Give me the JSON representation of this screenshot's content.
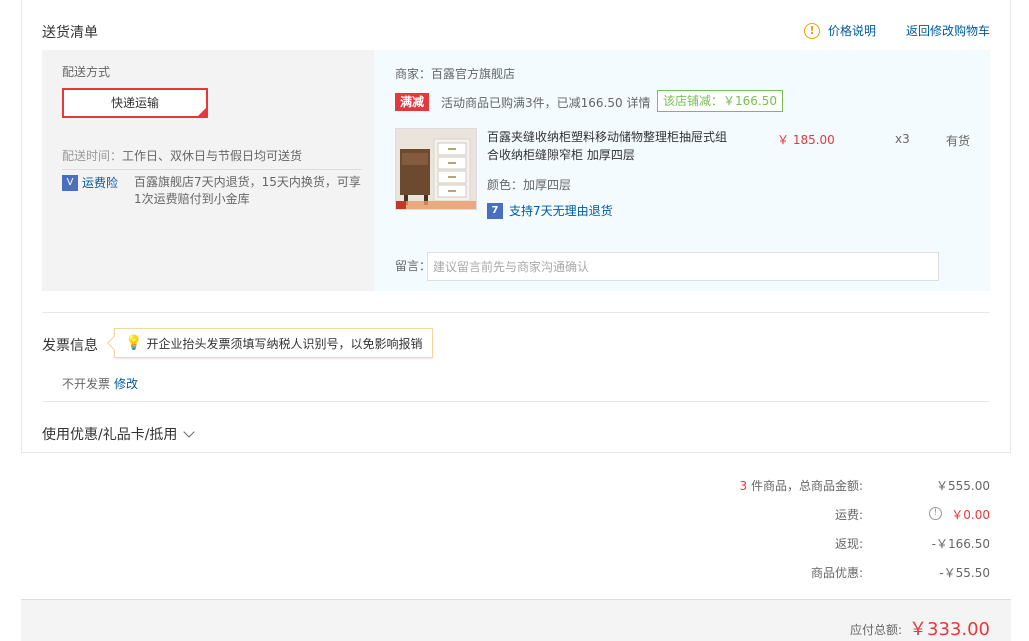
{
  "delivery": {
    "title": "送货清单",
    "price_help": "价格说明",
    "back_to_cart": "返回修改购物车",
    "method_title": "配送方式",
    "method_selected": "快递运输",
    "time_label": "配送时间：",
    "time_value": "工作日、双休日与节假日均可送货",
    "insurance_icon": "shield-icon",
    "insurance_label": "运费险",
    "insurance_desc": "百露旗舰店7天内退货，15天内换货，可享1次运费赔付到小金库"
  },
  "shop": {
    "merchant": "商家：百露官方旗舰店",
    "promo_tag": "满减",
    "promo_text": "活动商品已购满3件，已减166.50 详情",
    "shop_reduce": "该店铺减：￥166.50",
    "product": {
      "name": "百露夹缝收纳柜塑料移动储物整理柜抽屉式组合收纳柜缝隙窄柜 加厚四层",
      "color": "颜色：加厚四层",
      "return_badge": "7",
      "return_policy": "支持7天无理由退货",
      "price": "￥ 185.00",
      "qty": "x3",
      "stock": "有货"
    },
    "message_label": "留言：",
    "message_placeholder": "建议留言前先与商家沟通确认"
  },
  "invoice": {
    "title": "发票信息",
    "tip": "开企业抬头发票须填写纳税人识别号，以免影响报销",
    "value": "不开发票",
    "edit": "修改"
  },
  "coupon": {
    "label": "使用优惠/礼品卡/抵用"
  },
  "summary": {
    "count": "3",
    "items_label": " 件商品，总商品金额:",
    "items_total": "￥555.00",
    "freight_label": "运费:",
    "freight_value": "￥0.00",
    "cashback_label": "返现:",
    "cashback_value": "-￥166.50",
    "discount_label": "商品优惠:",
    "discount_value": "-￥55.50",
    "payable_label": "应付总额:",
    "payable_value": "￥333.00"
  },
  "colors": {
    "accent_red": "#e4393c",
    "link_blue": "#005aa0",
    "promo_green": "#7abd54"
  }
}
